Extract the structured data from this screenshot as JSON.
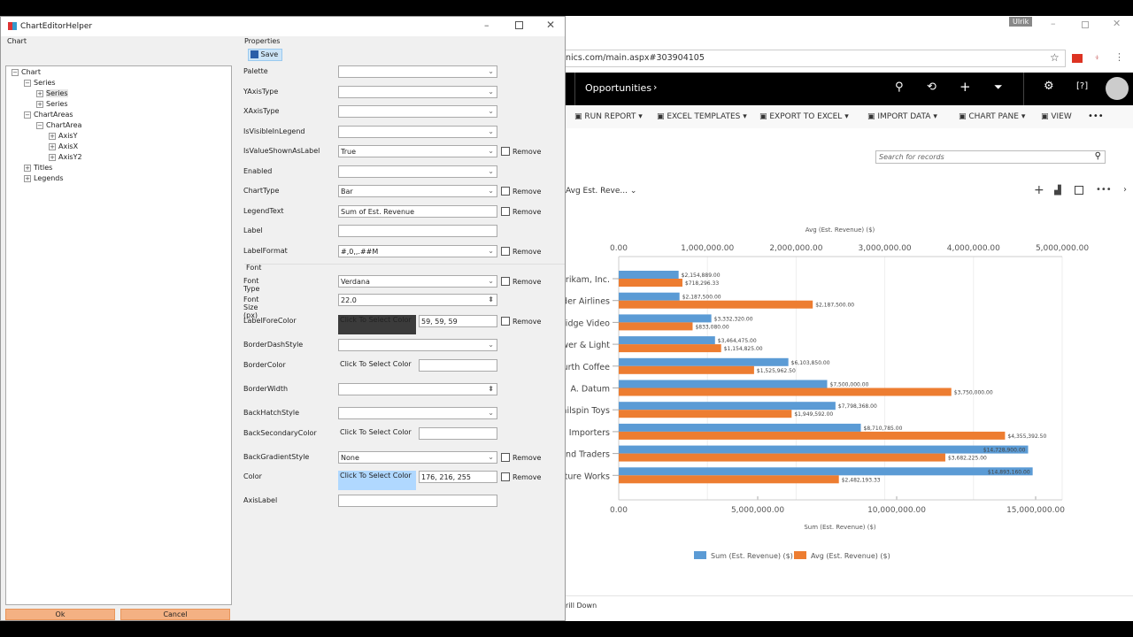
{
  "dialog": {
    "title": "ChartEditorHelper",
    "tree_group": "Chart",
    "tree": [
      {
        "label": "Chart",
        "level": 0,
        "sign": "-"
      },
      {
        "label": "Series",
        "level": 1,
        "sign": "-"
      },
      {
        "label": "Series",
        "level": 2,
        "sign": "+",
        "selected": true
      },
      {
        "label": "Series",
        "level": 2,
        "sign": "+"
      },
      {
        "label": "ChartAreas",
        "level": 1,
        "sign": "-"
      },
      {
        "label": "ChartArea",
        "level": 2,
        "sign": "-"
      },
      {
        "label": "AxisY",
        "level": 3,
        "sign": "+"
      },
      {
        "label": "AxisX",
        "level": 3,
        "sign": "+"
      },
      {
        "label": "AxisY2",
        "level": 3,
        "sign": "+"
      },
      {
        "label": "Titles",
        "level": 1,
        "sign": "+"
      },
      {
        "label": "Legends",
        "level": 1,
        "sign": "+"
      }
    ],
    "properties_group": "Properties",
    "save_label": "Save",
    "font_group": "Font",
    "remove_label": "Remove",
    "properties": [
      {
        "label": "Palette",
        "type": "select",
        "value": ""
      },
      {
        "label": "YAxisType",
        "type": "select",
        "value": ""
      },
      {
        "label": "XAxisType",
        "type": "select",
        "value": ""
      },
      {
        "label": "IsVisibleInLegend",
        "type": "select",
        "value": ""
      },
      {
        "label": "IsValueShownAsLabel",
        "type": "select",
        "value": "True",
        "remove": true
      },
      {
        "label": "Enabled",
        "type": "select",
        "value": ""
      },
      {
        "label": "ChartType",
        "type": "select",
        "value": "Bar",
        "remove": true
      },
      {
        "label": "LegendText",
        "type": "text",
        "value": "Sum of Est. Revenue",
        "remove": true
      },
      {
        "label": "Label",
        "type": "text",
        "value": ""
      },
      {
        "label": "LabelFormat",
        "type": "select",
        "value": "#,0,,.##M",
        "remove": true
      },
      {
        "label": "Font Type",
        "type": "select",
        "value": "Verdana",
        "remove": true
      },
      {
        "label": "Font Size (px)",
        "type": "spin",
        "value": "22.0"
      },
      {
        "label": "LabelForeColor",
        "type": "color",
        "swatch": "#3b3b3b",
        "value": "59, 59, 59",
        "remove": true
      },
      {
        "label": "BorderDashStyle",
        "type": "select",
        "value": ""
      },
      {
        "label": "BorderColor",
        "type": "color",
        "swatch": "",
        "value": ""
      },
      {
        "label": "BorderWidth",
        "type": "spin",
        "value": ""
      },
      {
        "label": "BackHatchStyle",
        "type": "select",
        "value": ""
      },
      {
        "label": "BackSecondaryColor",
        "type": "color",
        "swatch": "",
        "value": ""
      },
      {
        "label": "BackGradientStyle",
        "type": "select",
        "value": "None",
        "remove": true
      },
      {
        "label": "Color",
        "type": "color",
        "swatch": "#b0d8ff",
        "value": "176, 216, 255",
        "remove": true
      },
      {
        "label": "AxisLabel",
        "type": "text",
        "value": ""
      }
    ],
    "color_button_label": "Click To Select Color",
    "ok_label": "Ok",
    "cancel_label": "Cancel"
  },
  "browser": {
    "user_badge": "Ulrik",
    "url": "nics.com/main.aspx#303904105",
    "nav_title": "Opportunities",
    "commands": [
      "RUN REPORT",
      "EXCEL TEMPLATES",
      "EXPORT TO EXCEL",
      "IMPORT DATA",
      "CHART PANE",
      "VIEW"
    ],
    "search_placeholder": "Search for records",
    "chart_selector": "Avg Est. Reve...",
    "drill_down": "rill Down"
  },
  "colors": {
    "sum": "#5b9bd5",
    "avg": "#ed7d31",
    "nav": "#000000"
  },
  "chart_data": {
    "type": "bar",
    "orientation": "horizontal",
    "categories": [
      "brikam, Inc.",
      "der Airlines",
      "ridge Video",
      "wer & Light",
      "urth Coffee",
      "A. Datum",
      "ailspin Toys",
      "d Importers",
      "ind Traders",
      "ture Works"
    ],
    "series": [
      {
        "name": "Sum (Est. Revenue) ($)",
        "axis": "bottom",
        "values": [
          2154889,
          2187500,
          3332320,
          3464475,
          6103850,
          7500000,
          7798368,
          8710785,
          14728900,
          14893160
        ],
        "labels": [
          "$2,154,889.00",
          "$2,187,500.00",
          "$3,332,320.00",
          "$3,464,475.00",
          "$6,103,850.00",
          "$7,500,000.00",
          "$7,798,368.00",
          "$8,710,785.00",
          "$14,728,900.00",
          "$14,893,160.00"
        ]
      },
      {
        "name": "Avg (Est. Revenue) ($)",
        "axis": "top",
        "values": [
          718296.33,
          2187500,
          833080,
          1154825,
          1525962.5,
          3750000,
          1949592,
          4355392.5,
          3682225,
          2482193.33
        ],
        "labels": [
          "$718,296.33",
          "$2,187,500.00",
          "$833,080.00",
          "$1,154,825.00",
          "$1,525,962.50",
          "$3,750,000.00",
          "$1,949,592.00",
          "$4,355,392.50",
          "$3,682,225.00",
          "$2,482,193.33"
        ]
      }
    ],
    "top_axis": {
      "title": "Avg (Est. Revenue) ($)",
      "range": [
        0,
        5000000
      ],
      "ticks": [
        "0.00",
        "1,000,000.00",
        "2,000,000.00",
        "3,000,000.00",
        "4,000,000.00",
        "5,000,000.00"
      ]
    },
    "bottom_axis": {
      "title": "Sum (Est. Revenue) ($)",
      "range": [
        0,
        15000000
      ],
      "ticks": [
        "0.00",
        "5,000,000.00",
        "10,000,000.00",
        "15,000,000.00"
      ]
    },
    "legend_position": "bottom",
    "grid": true
  }
}
